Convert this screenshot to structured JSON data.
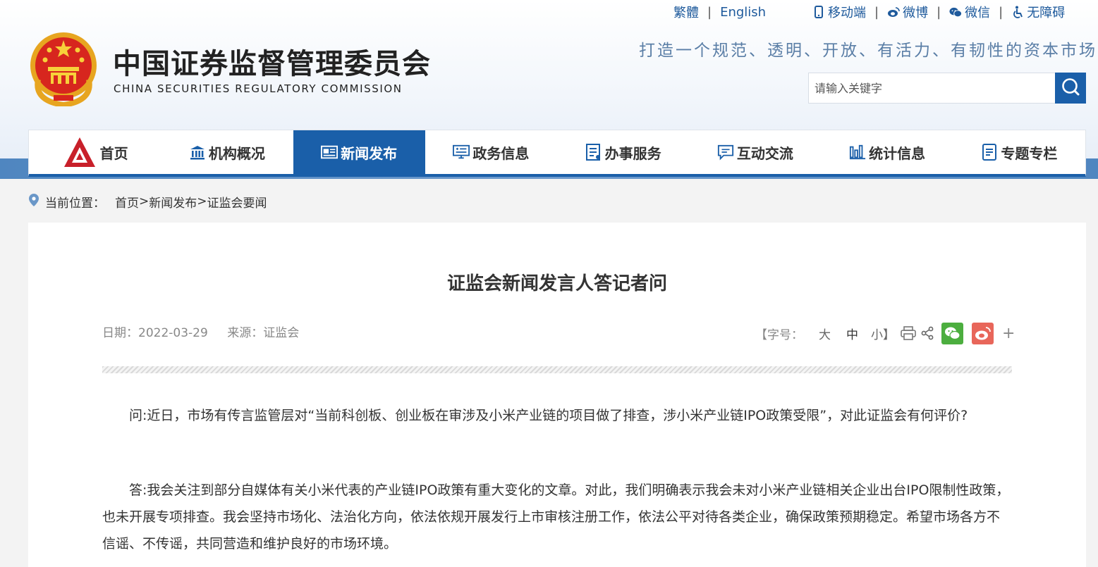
{
  "top_links": {
    "traditional": "繁體",
    "english": "English",
    "mobile": "移动端",
    "weibo": "微博",
    "wechat": "微信",
    "accessibility": "无障碍"
  },
  "header": {
    "title": "中国证券监督管理委员会",
    "subtitle": "CHINA SECURITIES REGULATORY COMMISSION",
    "slogan": "打造一个规范、透明、开放、有活力、有韧性的资本市场"
  },
  "search": {
    "placeholder": "请输入关键字"
  },
  "nav": [
    {
      "label": "首页",
      "icon": "csrc-logo-icon"
    },
    {
      "label": "机构概况",
      "icon": "building-icon"
    },
    {
      "label": "新闻发布",
      "icon": "newspaper-icon",
      "active": true
    },
    {
      "label": "政务信息",
      "icon": "monitor-icon"
    },
    {
      "label": "办事服务",
      "icon": "document-list-icon"
    },
    {
      "label": "互动交流",
      "icon": "chat-icon"
    },
    {
      "label": "统计信息",
      "icon": "bar-chart-icon"
    },
    {
      "label": "专题专栏",
      "icon": "note-icon"
    }
  ],
  "breadcrumb": {
    "label": "当前位置：",
    "items": [
      "首页",
      "新闻发布",
      "证监会要闻"
    ],
    "separator": ">"
  },
  "article": {
    "title": "证监会新闻发言人答记者问",
    "date": "日期：2022-03-29",
    "source": "来源：证监会",
    "font_size_label": "【字号：",
    "font_large": "大",
    "font_medium": "中",
    "font_small": "小】",
    "paragraphs": [
      "问:近日，市场有传言监管层对“当前科创板、创业板在审涉及小米产业链的项目做了排查，涉小米产业链IPO政策受限”，对此证监会有何评价?",
      "答:我会关注到部分自媒体有关小米代表的产业链IPO政策有重大变化的文章。对此，我们明确表示我会未对小米产业链相关企业出台IPO限制性政策，也未开展专项排查。我会坚持市场化、法治化方向，依法依规开展发行上市审核注册工作，依法公平对待各类企业，确保政策预期稳定。希望市场各方不信谣、不传谣，共同营造和维护良好的市场环境。"
    ],
    "more": "+"
  },
  "colors": {
    "brand_blue": "#1a5fa9",
    "link_blue": "#1e5a9c",
    "slogan": "#5a7ea6",
    "wechat_green": "#4cae3f",
    "weibo_orange": "#e8665a"
  }
}
